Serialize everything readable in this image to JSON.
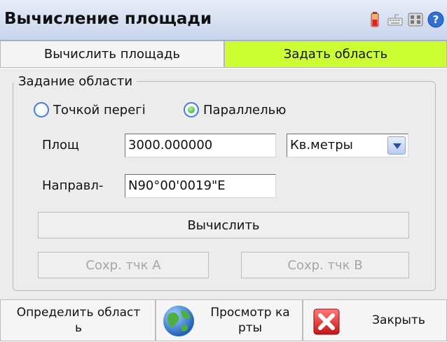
{
  "window": {
    "title": "Вычисление площади"
  },
  "tray": {
    "icons": [
      "battery-icon",
      "keyboard-icon",
      "network-icon",
      "help-icon"
    ]
  },
  "tabs": [
    {
      "label": "Вычислить площадь",
      "active": false
    },
    {
      "label": "Задать область",
      "active": true,
      "color": "#ccff33"
    }
  ],
  "group": {
    "legend": "Задание области",
    "radio_point": {
      "label": "Точкой перегі",
      "checked": false
    },
    "radio_parallel": {
      "label": "Параллелью",
      "checked": true
    },
    "area": {
      "label": "Площ",
      "value": "3000.000000"
    },
    "unit": {
      "selected": "Кв.метры"
    },
    "direction": {
      "label": "Направл-",
      "value": "N90°00'0019\"E"
    },
    "calculate_button": "Вычислить",
    "save_a_button": "Сохр. тчк А",
    "save_b_button": "Сохр. тчк В"
  },
  "bottom": {
    "define_area": [
      "Определить област",
      "ь"
    ],
    "view_map": [
      "Просмотр ка",
      "рты"
    ],
    "close": "Закрыть"
  }
}
